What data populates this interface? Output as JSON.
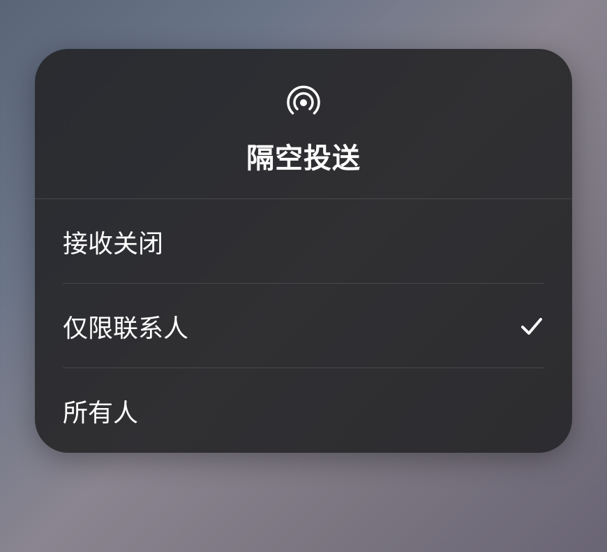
{
  "modal": {
    "title": "隔空投送",
    "iconName": "airdrop-icon",
    "options": [
      {
        "label": "接收关闭",
        "selected": false
      },
      {
        "label": "仅限联系人",
        "selected": true
      },
      {
        "label": "所有人",
        "selected": false
      }
    ]
  }
}
